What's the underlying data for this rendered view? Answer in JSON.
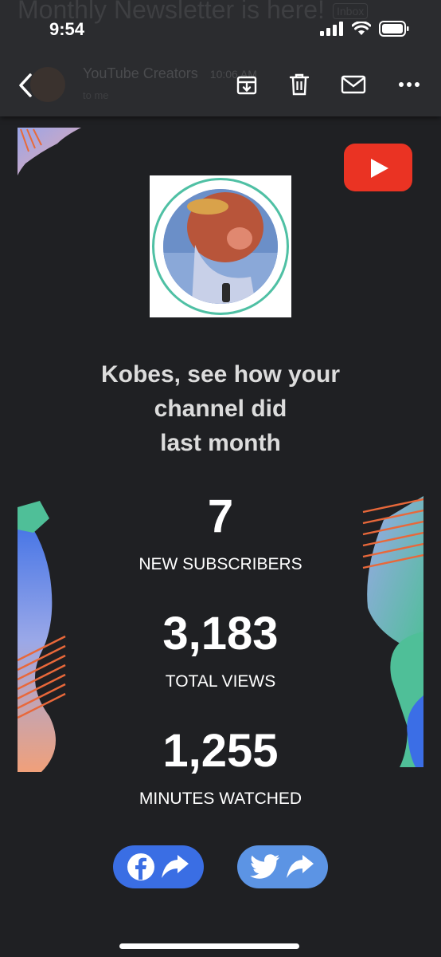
{
  "status_bar": {
    "time": "9:54"
  },
  "background_header": {
    "subject": "Monthly Newsletter is here!",
    "label_tag": "Inbox",
    "sender": "YouTube Creators",
    "sender_time": "10:06 AM",
    "recipient": "to me"
  },
  "toolbar": {
    "back": "back-icon",
    "archive": "archive-icon",
    "delete": "trash-icon",
    "mark_unread": "mail-icon",
    "more": "more-icon"
  },
  "email": {
    "headline_line1": "Kobes, see how your",
    "headline_line2": "channel did",
    "headline_line3": "last month",
    "stats": [
      {
        "value": "7",
        "label": "NEW SUBSCRIBERS"
      },
      {
        "value": "3,183",
        "label": "TOTAL VIEWS"
      },
      {
        "value": "1,255",
        "label": "MINUTES WATCHED"
      }
    ],
    "share_buttons": [
      {
        "network": "facebook-icon",
        "action": "share-arrow-icon"
      },
      {
        "network": "twitter-icon",
        "action": "share-arrow-icon"
      }
    ]
  },
  "colors": {
    "background": "#1f2023",
    "header": "#2b2c2f",
    "youtube_red": "#ea3323",
    "facebook_blue": "#3a6ee4",
    "twitter_blue": "#5c94e4",
    "avatar_ring": "#4fc0a4"
  }
}
